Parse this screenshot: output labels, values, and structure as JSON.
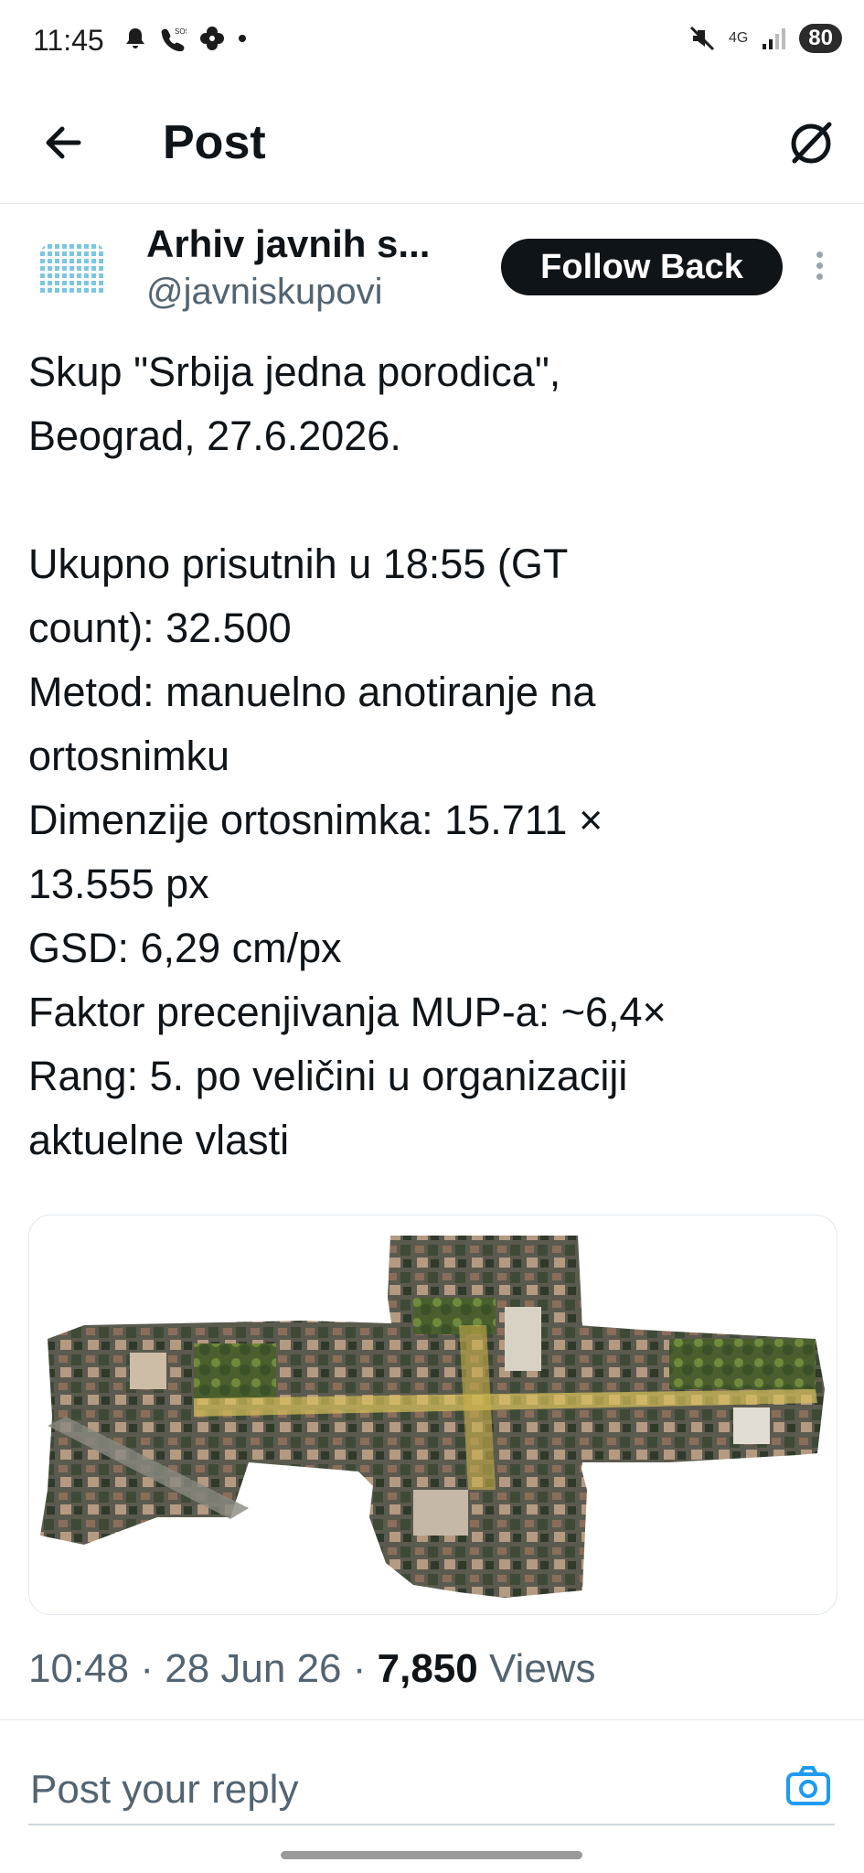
{
  "status_bar": {
    "time": "11:45",
    "left_icons": [
      "bell-icon",
      "sos-call-icon",
      "pinwheel-icon",
      "dot-icon"
    ],
    "network": "4G",
    "battery": "80"
  },
  "header": {
    "title": "Post"
  },
  "post": {
    "author_name": "Arhiv javnih s...",
    "author_handle": "@javniskupovi",
    "follow_label": "Follow Back",
    "text": "Skup \"Srbija jedna porodica\",\nBeograd, 27.6.2026.\n\nUkupno prisutnih u 18:55 (GT\ncount): 32.500\nMetod: manuelno anotiranje na\nortosnimku\nDimenzije ortosnimka: 15.711 ×\n13.555 px\nGSD: 6,29 cm/px\nFaktor precenjivanja MUP-a: ~6,4×\nRang: 5. po veličini u organizaciji\naktuelne vlasti",
    "time": "10:48",
    "date": "28 Jun 26",
    "views_count": "7,850",
    "views_label": "Views"
  },
  "reply": {
    "placeholder": "Post your reply"
  },
  "colors": {
    "text": "#0f1419",
    "secondary": "#536471",
    "accent": "#1d9bf0",
    "button_bg": "#0f1419"
  }
}
